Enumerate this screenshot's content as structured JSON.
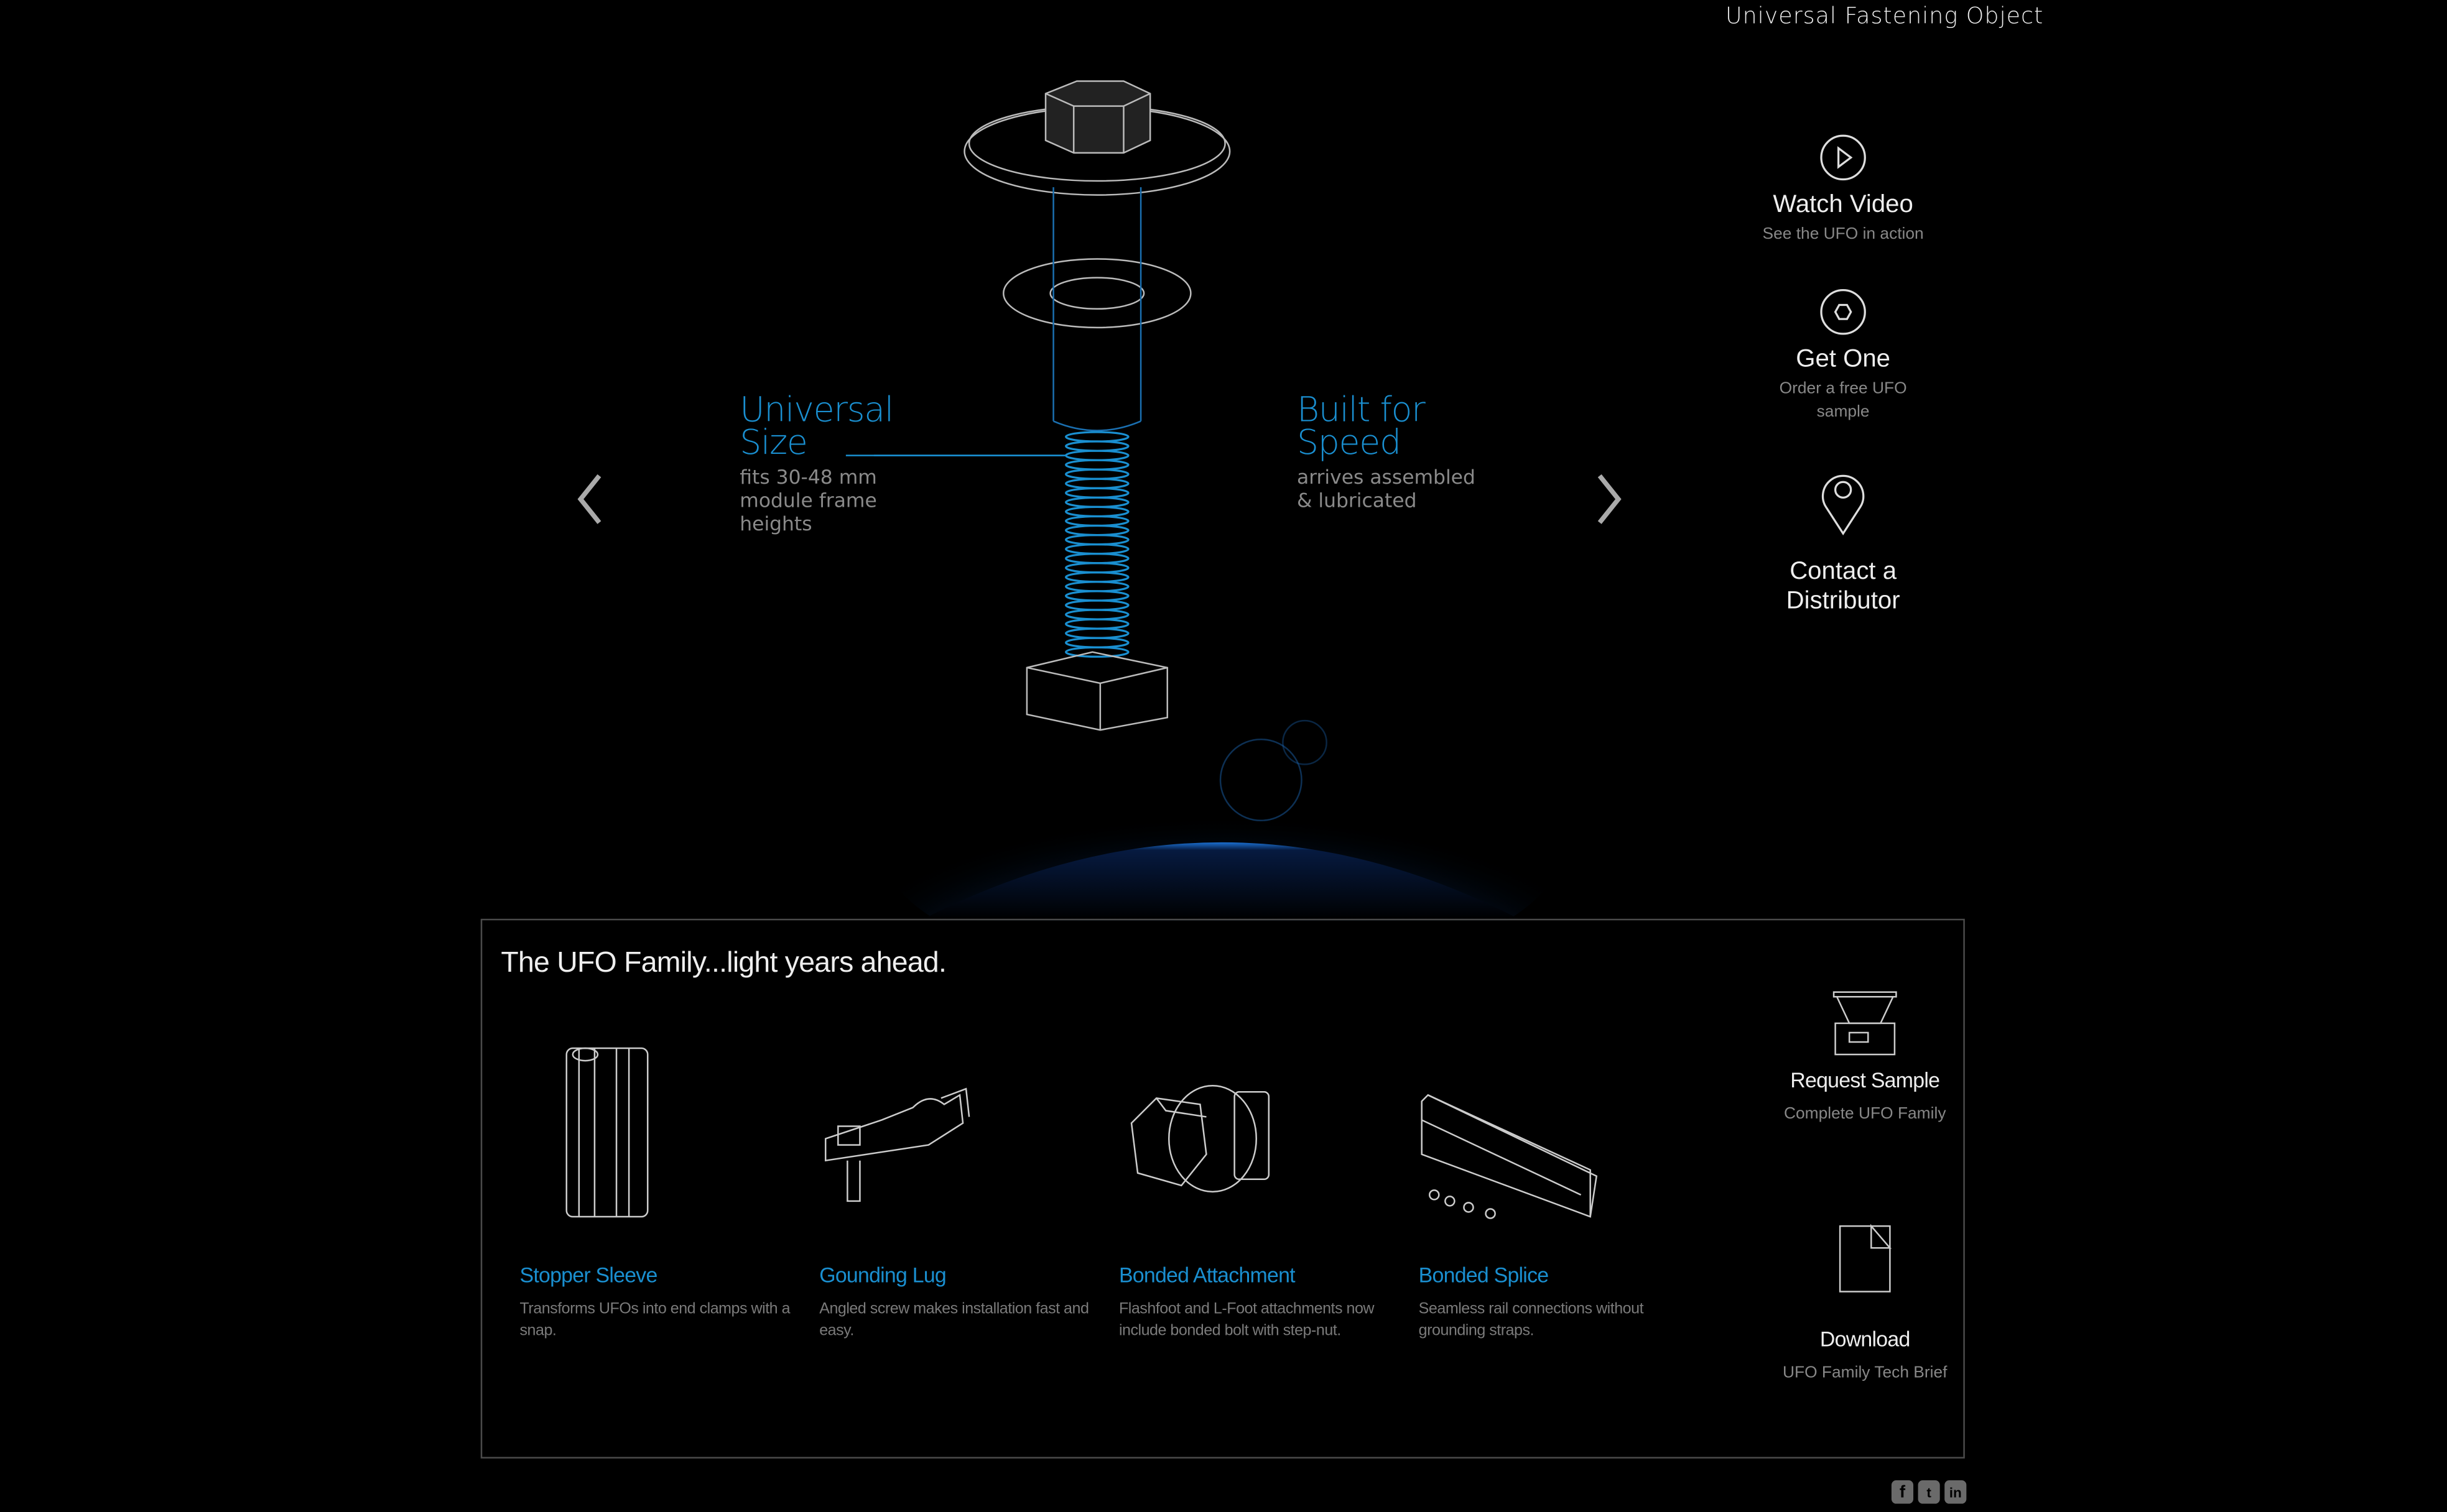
{
  "header": {
    "title": "Universal Fastening Object"
  },
  "nav": [
    {
      "label": "Watch Video",
      "sub": "See the UFO in action",
      "icon": "play-circle-icon"
    },
    {
      "label": "Get One",
      "sub": "Order a free UFO sample",
      "icon": "hex-circle-icon"
    },
    {
      "label": "Contact a Distributor",
      "sub": "",
      "icon": "map-pin-icon"
    }
  ],
  "hero": {
    "left_feature": {
      "title": "Universal Size",
      "sub": "fits 30-48 mm module frame heights"
    },
    "right_feature": {
      "title": "Built for Speed",
      "sub": "arrives assembled & lubricated"
    },
    "accent_color": "#1a8fd0"
  },
  "family": {
    "title": "The UFO Family...light years ahead.",
    "products": [
      {
        "name": "Stopper Sleeve",
        "desc": "Transforms UFOs into end clamps with a snap."
      },
      {
        "name": "Gounding Lug",
        "desc": "Angled screw makes installation fast and easy."
      },
      {
        "name": "Bonded Attachment",
        "desc": "Flashfoot and L-Foot attachments now include bonded bolt with step-nut."
      },
      {
        "name": "Bonded Splice",
        "desc": "Seamless rail connections without grounding straps."
      }
    ],
    "request": {
      "label": "Request Sample",
      "sub": "Complete UFO Family"
    },
    "download": {
      "label": "Download",
      "sub": "UFO Family Tech Brief"
    }
  },
  "social": [
    "facebook-icon",
    "twitter-icon",
    "linkedin-icon"
  ]
}
